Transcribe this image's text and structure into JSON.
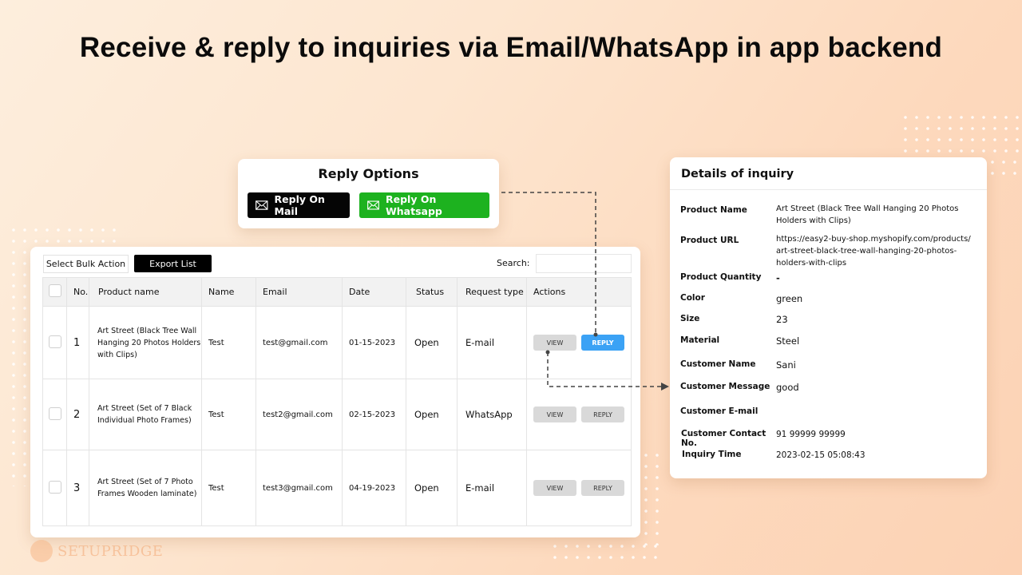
{
  "headline": "Receive & reply to inquiries via Email/WhatsApp in app backend",
  "reply_options": {
    "title": "Reply Options",
    "mail_button": "Reply On Mail",
    "whatsapp_button": "Reply On Whatsapp",
    "colors": {
      "mail": "#050505",
      "whatsapp": "#1db21f"
    }
  },
  "inquiry_table": {
    "bulk_action": "Select Bulk Action",
    "export_button": "Export List",
    "search_label": "Search:",
    "search_value": "",
    "columns": [
      "No.",
      "Product name",
      "Name",
      "Email",
      "Date",
      "Status",
      "Request type",
      "Actions"
    ],
    "rows": [
      {
        "no": "1",
        "product": "Art Street (Black Tree Wall Hanging 20 Photos Holders with Clips)",
        "name": "Test",
        "email": "test@gmail.com",
        "date": "01-15-2023",
        "status": "Open",
        "request_type": "E-mail",
        "view": "VIEW",
        "reply": "REPLY",
        "reply_active": true
      },
      {
        "no": "2",
        "product": "Art Street (Set of 7 Black Individual Photo Frames)",
        "name": "Test",
        "email": "test2@gmail.com",
        "date": "02-15-2023",
        "status": "Open",
        "request_type": "WhatsApp",
        "view": "VIEW",
        "reply": "REPLY",
        "reply_active": false
      },
      {
        "no": "3",
        "product": "Art Street (Set of 7 Photo Frames Wooden laminate)",
        "name": "Test",
        "email": "test3@gmail.com",
        "date": "04-19-2023",
        "status": "Open",
        "request_type": "E-mail",
        "view": "VIEW",
        "reply": "REPLY",
        "reply_active": false
      }
    ],
    "active_reply_color": "#3ba2f5"
  },
  "details": {
    "title": "Details of inquiry",
    "fields": [
      {
        "label": "Product Name",
        "value": "Art Street (Black Tree Wall Hanging 20 Photos Holders with Clips)"
      },
      {
        "label": "Product URL",
        "value": "https://easy2-buy-shop.myshopify.com/products/ art-street-black-tree-wall-hanging-20-photos- holders-with-clips"
      },
      {
        "label": "Product Quantity",
        "value": "-"
      },
      {
        "label": "Color",
        "value": "green"
      },
      {
        "label": "Size",
        "value": "23"
      },
      {
        "label": "Material",
        "value": "Steel"
      },
      {
        "label": "Customer Name",
        "value": "Sani"
      },
      {
        "label": "Customer Message",
        "value": "good"
      },
      {
        "label": "Customer E-mail",
        "value": ""
      },
      {
        "label": "Customer Contact No.",
        "value": "91 99999 99999"
      },
      {
        "label": "Inquiry Time",
        "value": "2023-02-15 05:08:43"
      }
    ]
  },
  "brand": {
    "name": "SETUPRIDGE"
  }
}
